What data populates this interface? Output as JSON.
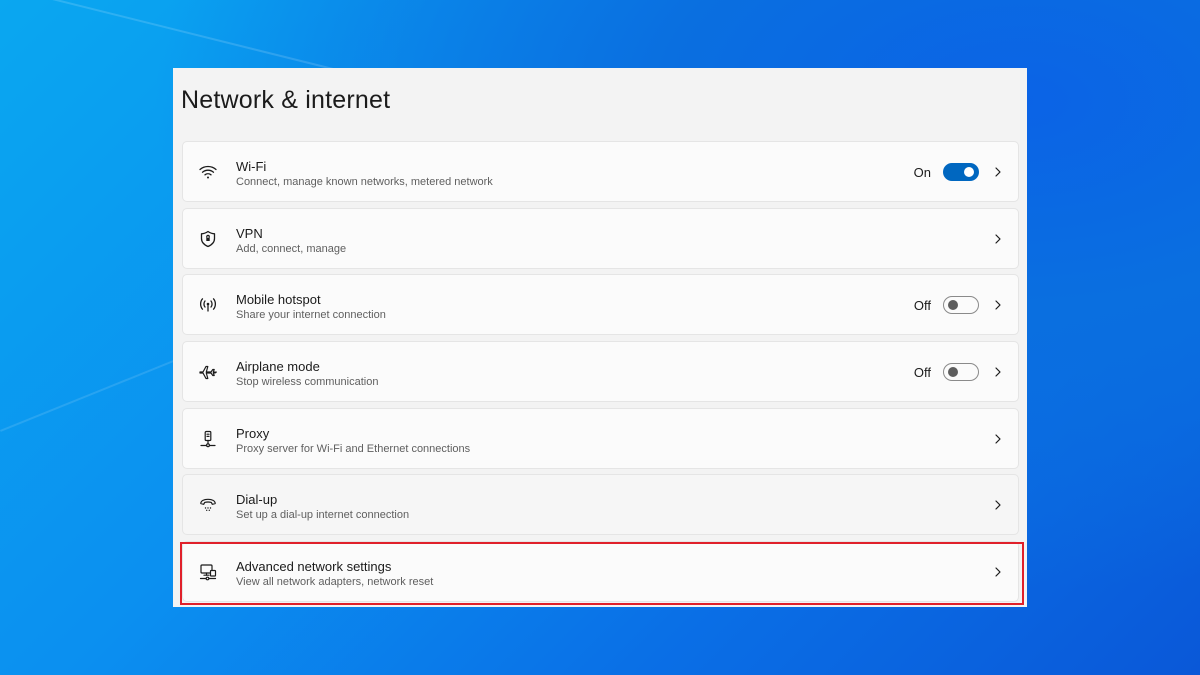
{
  "window": {
    "title": "Network & internet"
  },
  "items": [
    {
      "title": "Wi-Fi",
      "subtitle": "Connect, manage known networks, metered network",
      "state": "On",
      "icon": "wifi-icon"
    },
    {
      "title": "VPN",
      "subtitle": "Add, connect, manage",
      "icon": "vpn-shield-icon"
    },
    {
      "title": "Mobile hotspot",
      "subtitle": "Share your internet connection",
      "state": "Off",
      "icon": "hotspot-icon"
    },
    {
      "title": "Airplane mode",
      "subtitle": "Stop wireless communication",
      "state": "Off",
      "icon": "airplane-icon"
    },
    {
      "title": "Proxy",
      "subtitle": "Proxy server for Wi-Fi and Ethernet connections",
      "icon": "proxy-icon"
    },
    {
      "title": "Dial-up",
      "subtitle": "Set up a dial-up internet connection",
      "icon": "dialup-phone-icon"
    },
    {
      "title": "Advanced network settings",
      "subtitle": "View all network adapters, network reset",
      "icon": "network-adapter-icon"
    }
  ],
  "colors": {
    "accent": "#0067c0",
    "highlight": "#e0202a"
  }
}
